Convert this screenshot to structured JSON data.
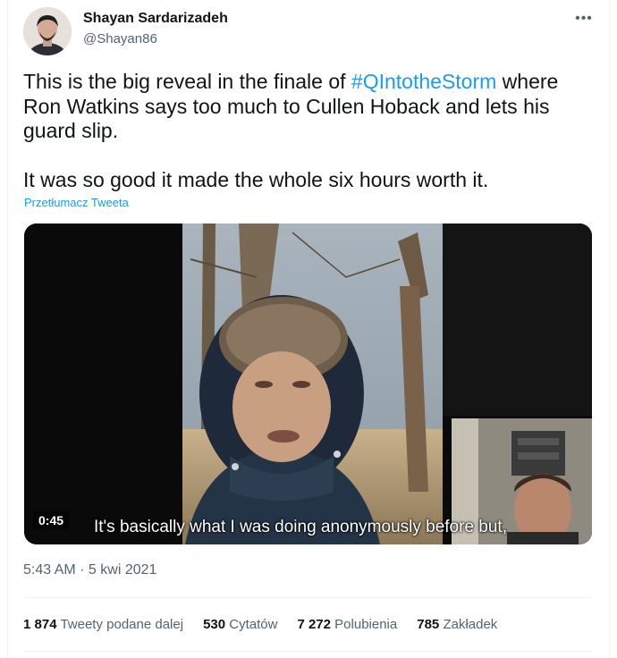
{
  "author": {
    "name": "Shayan Sardarizadeh",
    "handle": "@Shayan86"
  },
  "more_icon": "more-horizontal-icon",
  "tweet": {
    "line1_prefix": "This is the big reveal in the finale of ",
    "hashtag": "#QIntotheStorm",
    "line1_rest": "where Ron Watkins says too much to Cullen Hoback and lets his guard slip.",
    "line2": "It was so good it made the whole six hours worth it."
  },
  "translate_link": "Przetłumacz Tweeta",
  "video": {
    "duration": "0:45",
    "subtitle": "It's basically what I was doing anonymously before but,"
  },
  "timestamp": "5:43 AM · 5 kwi 2021",
  "stats": [
    {
      "num": "1 874",
      "label": "Tweety podane dalej"
    },
    {
      "num": "530",
      "label": "Cytatów"
    },
    {
      "num": "7 272",
      "label": "Polubienia"
    },
    {
      "num": "785",
      "label": "Zakładek"
    }
  ],
  "colors": {
    "accent": "#1d9bf0",
    "text": "#0f1419",
    "muted": "#536471"
  }
}
